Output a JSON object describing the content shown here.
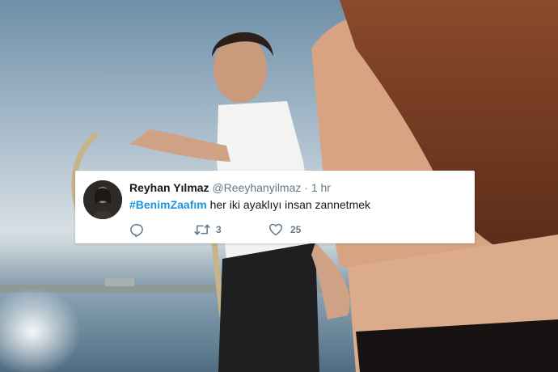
{
  "tweet": {
    "display_name": "Reyhan Yılmaz",
    "handle": "@Reeyhanyilmaz",
    "separator": "·",
    "time": "1 hr",
    "hashtag": "#BenimZaafım",
    "text": " her iki ayaklıyı insan zannetmek",
    "retweet_count": "3",
    "like_count": "25"
  },
  "icons": {
    "reply": "reply-icon",
    "retweet": "retweet-icon",
    "like": "heart-icon"
  },
  "colors": {
    "hashtag": "#1b95e0",
    "name": "#14171a",
    "muted": "#657786"
  }
}
